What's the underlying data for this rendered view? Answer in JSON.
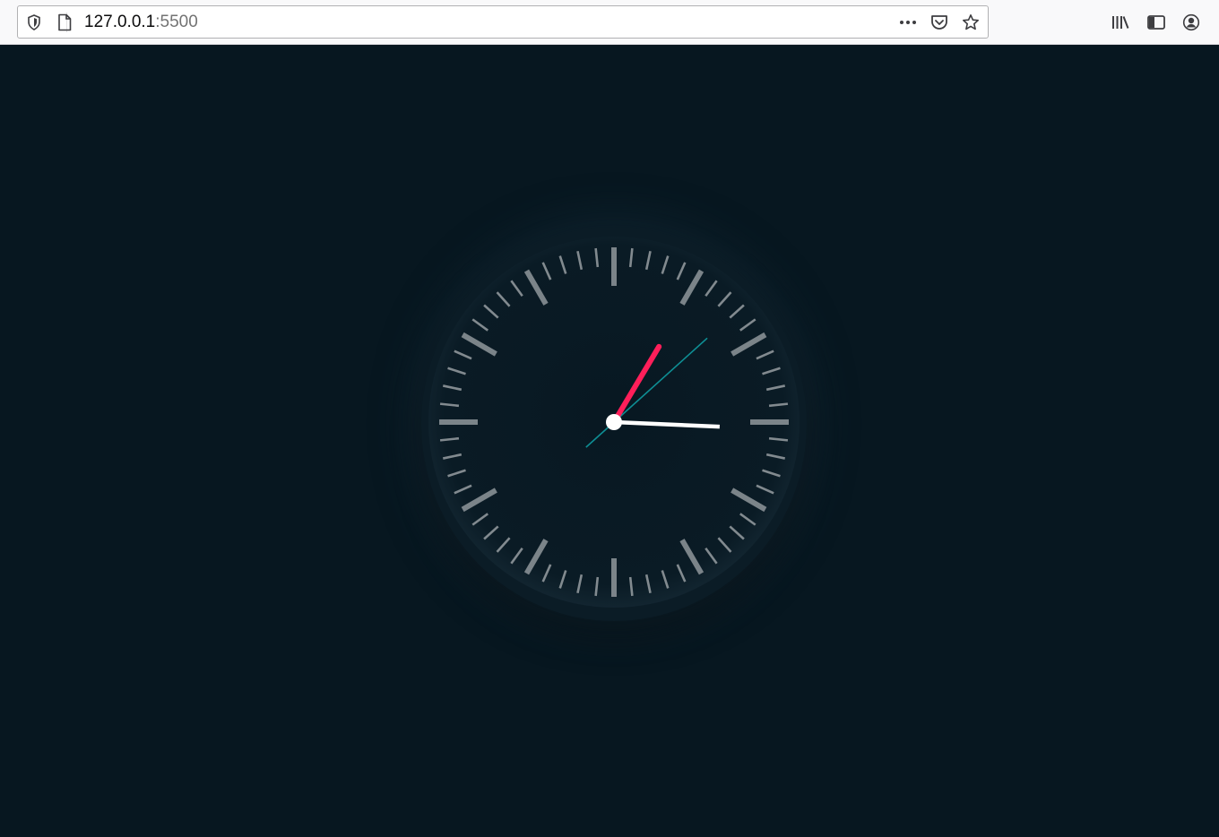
{
  "browser": {
    "url_host": "127.0.0.1",
    "url_port": ":5500",
    "icons": {
      "tracking": "shield-icon",
      "page": "page-icon",
      "more": "more-dots-icon",
      "pocket": "pocket-icon",
      "bookmark": "star-icon",
      "library": "library-icon",
      "sidebar": "sidebar-icon",
      "account": "account-icon"
    }
  },
  "clock": {
    "time": {
      "hour": 3,
      "minute": 5,
      "second": 8
    },
    "colors": {
      "background": "#071720",
      "face": "#0b1c26",
      "tick": "#8f979b",
      "hour_hand": "#ffffff",
      "minute_hand": "#ff1f5a",
      "second_hand": "#0e8e94",
      "center": "#ffffff"
    },
    "tick_count": 60
  }
}
